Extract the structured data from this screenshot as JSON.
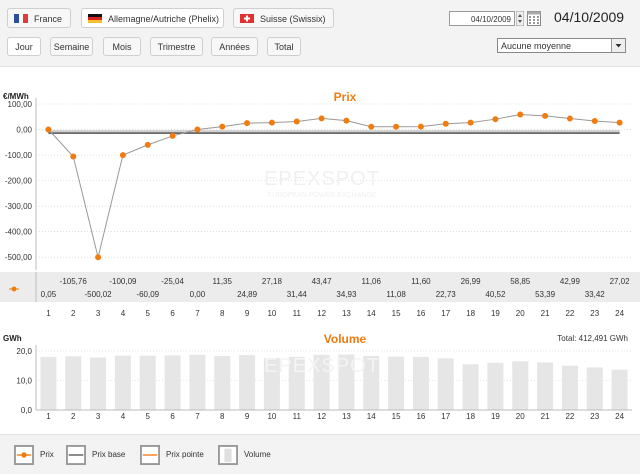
{
  "markets": [
    {
      "label": "France",
      "active": false,
      "flag": "france-flag-icon"
    },
    {
      "label": "Allemagne/Autriche (Phelix)",
      "active": true,
      "flag": "germany-flag-icon"
    },
    {
      "label": "Suisse (Swissix)",
      "active": false,
      "flag": "switzerland-flag-icon"
    }
  ],
  "periods": [
    {
      "label": "Jour",
      "active": true
    },
    {
      "label": "Semaine",
      "active": false
    },
    {
      "label": "Mois",
      "active": false
    },
    {
      "label": "Trimestre",
      "active": false
    },
    {
      "label": "Années",
      "active": false
    },
    {
      "label": "Total",
      "active": false
    }
  ],
  "date_input": "04/10/2009",
  "date_display": "04/10/2009",
  "average_select": "Aucune moyenne",
  "watermark": {
    "brand": "EPEXSPOT",
    "tagline": "EUROPEAN POWER EXCHANGE"
  },
  "price_chart": {
    "title": "Prix",
    "unit": "€/MWh",
    "row_label": "€",
    "total": ""
  },
  "volume_chart": {
    "title": "Volume",
    "unit": "GWh",
    "total": "Total: 412,491 GWh"
  },
  "legend": [
    {
      "label": "Prix",
      "icon": "prix-legend-icon"
    },
    {
      "label": "Prix base",
      "icon": "prix-base-legend-icon"
    },
    {
      "label": "Prix pointe",
      "icon": "prix-pointe-legend-icon"
    },
    {
      "label": "Volume",
      "icon": "volume-legend-icon"
    }
  ],
  "colors": {
    "accent": "#f07c10",
    "base_line": "#555555",
    "bar": "#e6e6e6",
    "grid": "#cccccc"
  },
  "chart_data": [
    {
      "type": "line",
      "title": "Prix",
      "ylabel": "€/MWh",
      "xlabel": "",
      "x": [
        1,
        2,
        3,
        4,
        5,
        6,
        7,
        8,
        9,
        10,
        11,
        12,
        13,
        14,
        15,
        16,
        17,
        18,
        19,
        20,
        21,
        22,
        23,
        24
      ],
      "series": [
        {
          "name": "Prix",
          "values": [
            0.05,
            -105.76,
            -500.02,
            -100.09,
            -60.09,
            -25.04,
            0.0,
            11.35,
            24.89,
            27.18,
            31.44,
            43.47,
            34.93,
            11.06,
            11.08,
            11.6,
            22.73,
            26.99,
            40.52,
            58.85,
            53.39,
            42.99,
            33.42,
            27.02
          ]
        }
      ],
      "data_labels": [
        "0,05",
        "-105,76",
        "-500,02",
        "-100,09",
        "-60,09",
        "-25,04",
        "0,00",
        "11,35",
        "24,89",
        "27,18",
        "31,44",
        "43,47",
        "34,93",
        "11,06",
        "11,08",
        "11,60",
        "22,73",
        "26,99",
        "40,52",
        "58,85",
        "53,39",
        "42,99",
        "33,42",
        "27,02"
      ],
      "base_price": -14,
      "ylim": [
        -550,
        100
      ],
      "y_ticks": [
        100,
        0,
        -100,
        -200,
        -300,
        -400,
        -500
      ],
      "y_tick_labels": [
        "100,00",
        "0,00",
        "-100,00",
        "-200,00",
        "-300,00",
        "-400,00",
        "-500,00"
      ],
      "grid": true
    },
    {
      "type": "bar",
      "title": "Volume",
      "ylabel": "GWh",
      "categories": [
        "1",
        "2",
        "3",
        "4",
        "5",
        "6",
        "7",
        "8",
        "9",
        "10",
        "11",
        "12",
        "13",
        "14",
        "15",
        "16",
        "17",
        "18",
        "19",
        "20",
        "21",
        "22",
        "23",
        "24"
      ],
      "values": [
        18.0,
        18.2,
        17.8,
        18.4,
        18.4,
        18.5,
        18.7,
        18.3,
        18.6,
        17.6,
        18.0,
        18.7,
        18.8,
        18.3,
        18.1,
        18.0,
        17.5,
        15.5,
        16.0,
        16.5,
        16.1,
        15.0,
        14.4,
        13.7
      ],
      "ylim": [
        0,
        20
      ],
      "y_ticks": [
        0,
        10,
        20
      ],
      "y_tick_labels": [
        "0,0",
        "10,0",
        "20,0"
      ],
      "grid": true
    }
  ]
}
